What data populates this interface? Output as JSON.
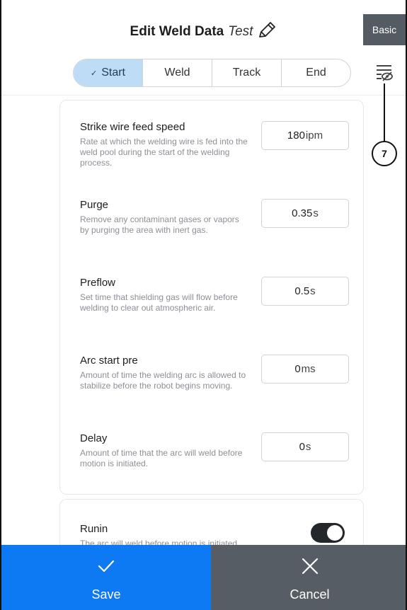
{
  "header": {
    "title": "Edit Weld Data",
    "name": "Test",
    "basic_label": "Basic"
  },
  "tabs": [
    {
      "label": "Start",
      "active": true
    },
    {
      "label": "Weld",
      "active": false
    },
    {
      "label": "Track",
      "active": false
    },
    {
      "label": "End",
      "active": false
    }
  ],
  "annotation": {
    "label": "7"
  },
  "settings": [
    {
      "label": "Strike wire feed speed",
      "description": "Rate at which the welding wire is fed into the weld pool during the start of the welding process.",
      "value": "180",
      "unit": "ipm"
    },
    {
      "label": "Purge",
      "description": "Remove any contaminant gases or vapors by purging the area with inert gas.",
      "value": "0.35",
      "unit": "s"
    },
    {
      "label": "Preflow",
      "description": "Set time that shielding gas will flow before welding to clear out atmospheric air.",
      "value": "0.5",
      "unit": "s"
    },
    {
      "label": "Arc start pre",
      "description": "Amount of time the welding arc is allowed to stabilize before the robot begins moving.",
      "value": "0",
      "unit": "ms"
    },
    {
      "label": "Delay",
      "description": "Amount of time that the arc will weld before motion is initiated.",
      "value": "0",
      "unit": "s"
    }
  ],
  "runin": {
    "label": "Runin",
    "description": "The arc will weld before motion is initiated",
    "enabled": true
  },
  "actions": {
    "save_label": "Save",
    "cancel_label": "Cancel"
  },
  "icons": {
    "pencil": "pencil-icon",
    "filter": "filter-visibility-icon",
    "check": "check-icon",
    "close": "close-icon"
  },
  "colors": {
    "save": "#0d79f2",
    "cancel": "#575d64",
    "active_tab": "#bfdcf7",
    "basic": "#555b63"
  }
}
